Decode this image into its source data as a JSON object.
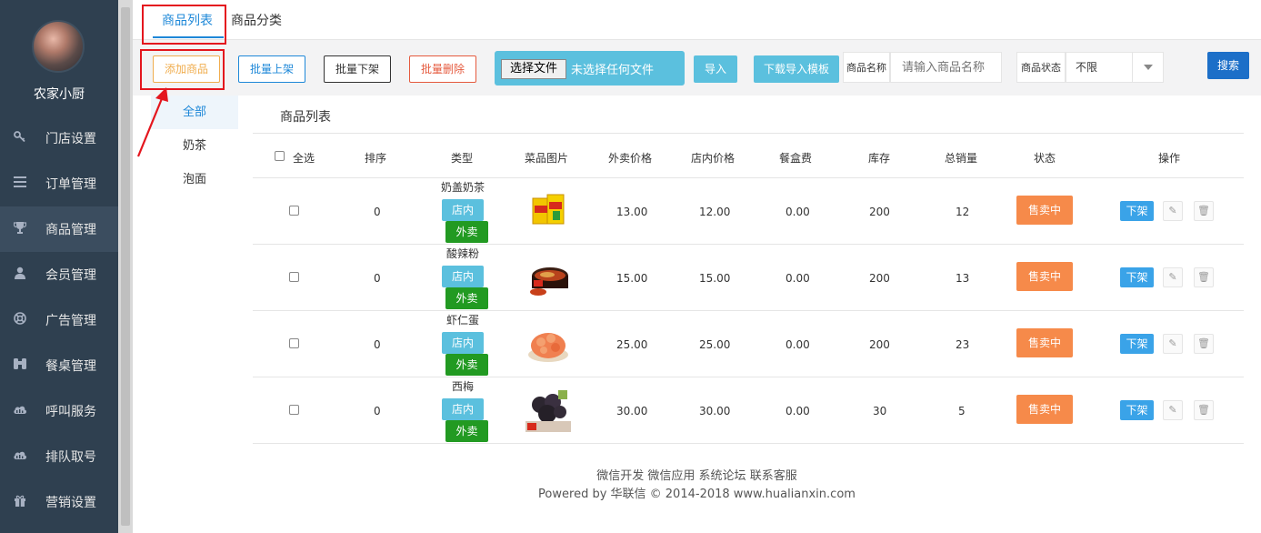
{
  "sidebar": {
    "shop_name": "农家小厨",
    "items": [
      {
        "label": "门店设置",
        "icon": "key-icon"
      },
      {
        "label": "订单管理",
        "icon": "list-icon"
      },
      {
        "label": "商品管理",
        "icon": "trophy-icon"
      },
      {
        "label": "会员管理",
        "icon": "user-icon"
      },
      {
        "label": "广告管理",
        "icon": "lifebuoy-icon"
      },
      {
        "label": "餐桌管理",
        "icon": "binoculars-icon"
      },
      {
        "label": "呼叫服务",
        "icon": "cloud-icon"
      },
      {
        "label": "排队取号",
        "icon": "cloud-icon"
      },
      {
        "label": "营销设置",
        "icon": "gift-icon"
      }
    ],
    "active_index": 2
  },
  "tabs": [
    {
      "label": "商品列表"
    },
    {
      "label": "商品分类"
    }
  ],
  "toolbar": {
    "add_label": "添加商品",
    "batch_up_label": "批量上架",
    "batch_down_label": "批量下架",
    "batch_delete_label": "批量删除",
    "file_button_label": "选择文件",
    "file_status": "未选择任何文件",
    "import_label": "导入",
    "template_label": "下载导入模板",
    "name_label": "商品名称",
    "name_placeholder": "请输入商品名称",
    "status_label": "商品状态",
    "status_value": "不限",
    "search_label": "搜索"
  },
  "categories": [
    "全部",
    "奶茶",
    "泡面"
  ],
  "list_title": "商品列表",
  "table": {
    "headers": {
      "select_all": "全选",
      "sort": "排序",
      "type": "类型",
      "image": "菜品图片",
      "takeout_price": "外卖价格",
      "dinein_price": "店内价格",
      "box_fee": "餐盒费",
      "stock": "库存",
      "sales": "总销量",
      "status": "状态",
      "actions": "操作"
    },
    "rows": [
      {
        "sort": "0",
        "name": "奶盖奶茶",
        "tag_in": "店内",
        "tag_out": "外卖",
        "takeout_price": "13.00",
        "dinein_price": "12.00",
        "box_fee": "0.00",
        "stock": "200",
        "sales": "12",
        "status": "售卖中",
        "action": "下架",
        "image": "milk-tea-image"
      },
      {
        "sort": "0",
        "name": "酸辣粉",
        "tag_in": "店内",
        "tag_out": "外卖",
        "takeout_price": "15.00",
        "dinein_price": "15.00",
        "box_fee": "0.00",
        "stock": "200",
        "sales": "13",
        "status": "售卖中",
        "action": "下架",
        "image": "noodles-image"
      },
      {
        "sort": "0",
        "name": "虾仁蛋",
        "tag_in": "店内",
        "tag_out": "外卖",
        "takeout_price": "25.00",
        "dinein_price": "25.00",
        "box_fee": "0.00",
        "stock": "200",
        "sales": "23",
        "status": "售卖中",
        "action": "下架",
        "image": "shrimp-egg-image"
      },
      {
        "sort": "0",
        "name": "西梅",
        "tag_in": "店内",
        "tag_out": "外卖",
        "takeout_price": "30.00",
        "dinein_price": "30.00",
        "box_fee": "0.00",
        "stock": "30",
        "sales": "5",
        "status": "售卖中",
        "action": "下架",
        "image": "prune-image"
      }
    ]
  },
  "footer": {
    "links": "微信开发 微信应用 系统论坛 联系客服",
    "copyright": "Powered by 华联信 © 2014-2018 www.hualianxin.com"
  },
  "colors": {
    "sidebar_bg": "#2f4050",
    "accent": "#1e88d8",
    "info": "#5bc0de",
    "success": "#229a22",
    "status_orange": "#f68a4a",
    "highlight_red": "#e4161e"
  }
}
